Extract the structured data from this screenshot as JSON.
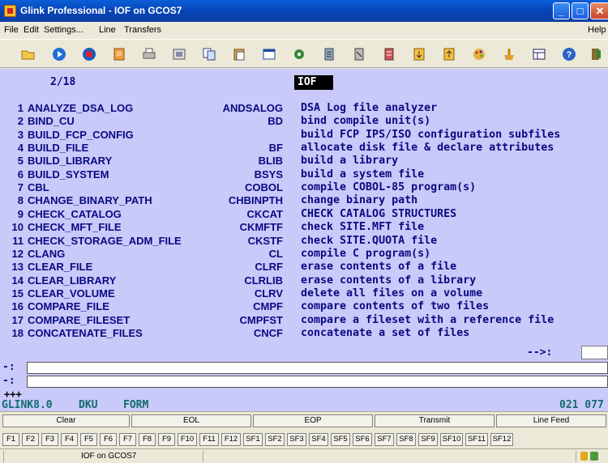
{
  "window": {
    "title": "Glink Professional - IOF on GCOS7"
  },
  "menu": {
    "items": [
      "File",
      "Edit",
      "Settings...",
      "Line",
      "Transfers"
    ],
    "help": "Help"
  },
  "toolbar": {
    "icons": [
      "open-folder-icon",
      "play-icon",
      "record-icon",
      "download-icon",
      "print-icon",
      "screen-icon",
      "copy-icon",
      "paste-icon",
      "window-icon",
      "settings-icon",
      "transfer-icon",
      "cursor-icon",
      "gear-icon",
      "send-icon",
      "receive-icon",
      "palette-icon",
      "keyboard-icon",
      "layout-icon",
      "help-icon",
      "exit-icon"
    ]
  },
  "terminal": {
    "page": "2/18",
    "mode": "IOF",
    "commands": [
      {
        "num": "1",
        "name": "ANALYZE_DSA_LOG",
        "abbr": "ANDSALOG",
        "desc": "DSA Log file analyzer"
      },
      {
        "num": "2",
        "name": "BIND_CU",
        "abbr": "BD",
        "desc": "bind compile unit(s)"
      },
      {
        "num": "3",
        "name": "BUILD_FCP_CONFIG",
        "abbr": "",
        "desc": "build FCP IPS/ISO configuration subfiles"
      },
      {
        "num": "4",
        "name": "BUILD_FILE",
        "abbr": "BF",
        "desc": "allocate disk file & declare attributes"
      },
      {
        "num": "5",
        "name": "BUILD_LIBRARY",
        "abbr": "BLIB",
        "desc": "build a library"
      },
      {
        "num": "6",
        "name": "BUILD_SYSTEM",
        "abbr": "BSYS",
        "desc": "build a system file"
      },
      {
        "num": "7",
        "name": "CBL",
        "abbr": "COBOL",
        "desc": "compile COBOL-85 program(s)"
      },
      {
        "num": "8",
        "name": "CHANGE_BINARY_PATH",
        "abbr": "CHBINPTH",
        "desc": "change binary path"
      },
      {
        "num": "9",
        "name": "CHECK_CATALOG",
        "abbr": "CKCAT",
        "desc": "CHECK CATALOG STRUCTURES"
      },
      {
        "num": "10",
        "name": "CHECK_MFT_FILE",
        "abbr": "CKMFTF",
        "desc": "check SITE.MFT file"
      },
      {
        "num": "11",
        "name": "CHECK_STORAGE_ADM_FILE",
        "abbr": "CKSTF",
        "desc": "check SITE.QUOTA file"
      },
      {
        "num": "12",
        "name": "CLANG",
        "abbr": "CL",
        "desc": "compile C program(s)"
      },
      {
        "num": "13",
        "name": "CLEAR_FILE",
        "abbr": "CLRF",
        "desc": "erase contents of a file"
      },
      {
        "num": "14",
        "name": "CLEAR_LIBRARY",
        "abbr": "CLRLIB",
        "desc": "erase contents of a library"
      },
      {
        "num": "15",
        "name": "CLEAR_VOLUME",
        "abbr": "CLRV",
        "desc": "delete all files on a volume"
      },
      {
        "num": "16",
        "name": "COMPARE_FILE",
        "abbr": "CMPF",
        "desc": "compare contents of two files"
      },
      {
        "num": "17",
        "name": "COMPARE_FILESET",
        "abbr": "CMPFST",
        "desc": "compare a fileset with a reference file"
      },
      {
        "num": "18",
        "name": "CONCATENATE_FILES",
        "abbr": "CNCF",
        "desc": "concatenate a set of files"
      }
    ],
    "prompt": "-->:",
    "input_label_1": "-:",
    "input_label_2": "-:",
    "plus": "+++",
    "status_left": "GLINK8.0",
    "status_dku": "DKU",
    "status_form": "FORM",
    "status_right": "021 077"
  },
  "function_bar": [
    "Clear",
    "EOL",
    "EOP",
    "Transmit",
    "Line Feed"
  ],
  "fkeys": [
    "F1",
    "F2",
    "F3",
    "F4",
    "F5",
    "F6",
    "F7",
    "F8",
    "F9",
    "F10",
    "F11",
    "F12",
    "SF1",
    "SF2",
    "SF3",
    "SF4",
    "SF5",
    "SF6",
    "SF7",
    "SF8",
    "SF9",
    "SF10",
    "SF11",
    "SF12"
  ],
  "statusbar": {
    "text": "IOF on GCOS7"
  },
  "colors": {
    "terminal_bg": "#c9c9fa",
    "terminal_text": "#0a0a82",
    "status_text": "#116c6c"
  }
}
